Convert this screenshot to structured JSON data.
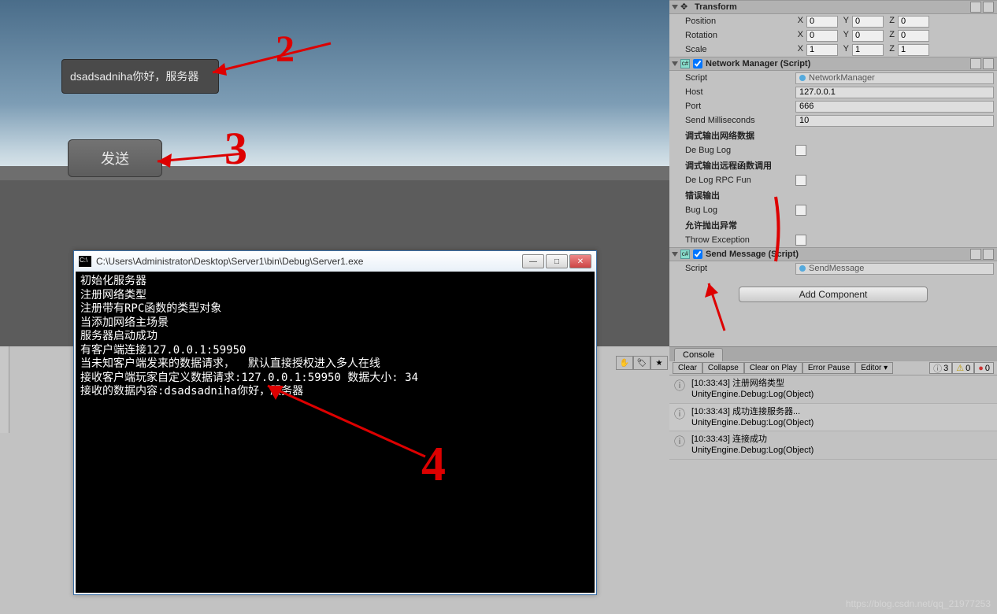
{
  "game": {
    "input_text": "dsadsadniha你好，服务器",
    "send_btn": "发送"
  },
  "cmd": {
    "title": "C:\\Users\\Administrator\\Desktop\\Server1\\bin\\Debug\\Server1.exe",
    "lines": [
      "初始化服务器",
      "注册网络类型",
      "注册带有RPC函数的类型对象",
      "当添加网络主场景",
      "服务器启动成功",
      "有客户端连接127.0.0.1:59950",
      "当未知客户端发来的数据请求，  默认直接授权进入多人在线",
      "接收客户端玩家自定义数据请求:127.0.0.1:59950 数据大小: 34",
      "接收的数据内容:dsadsadniha你好，服务器"
    ]
  },
  "inspector": {
    "transform": {
      "title": "Transform",
      "pos": "Position",
      "rot": "Rotation",
      "scl": "Scale",
      "px": "0",
      "py": "0",
      "pz": "0",
      "rx": "0",
      "ry": "0",
      "rz": "0",
      "sx": "1",
      "sy": "1",
      "sz": "1"
    },
    "netmgr": {
      "title": "Network Manager (Script)",
      "script_label": "Script",
      "script_val": "NetworkManager",
      "host_label": "Host",
      "host_val": "127.0.0.1",
      "port_label": "Port",
      "port_val": "666",
      "ms_label": "Send Milliseconds",
      "ms_val": "10",
      "g1": "调式输出网络数据",
      "g1f": "De Bug Log",
      "g2": "调式输出远程函数调用",
      "g2f": "De Log RPC Fun",
      "g3": "错误输出",
      "g3f": "Bug Log",
      "g4": "允许抛出异常",
      "g4f": "Throw Exception"
    },
    "sendmsg": {
      "title": "Send Message (Script)",
      "script_label": "Script",
      "script_val": "SendMessage"
    },
    "add_component": "Add Component"
  },
  "console": {
    "tab": "Console",
    "buttons": {
      "clear": "Clear",
      "collapse": "Collapse",
      "cop": "Clear on Play",
      "ep": "Error Pause",
      "editor": "Editor ▾"
    },
    "counts": {
      "info": "3",
      "warn": "0",
      "err": "0"
    },
    "logs": [
      {
        "time": "[10:33:43]",
        "msg": "注册网络类型",
        "sub": "UnityEngine.Debug:Log(Object)"
      },
      {
        "time": "[10:33:43]",
        "msg": "成功连接服务器...",
        "sub": "UnityEngine.Debug:Log(Object)"
      },
      {
        "time": "[10:33:43]",
        "msg": "连接成功",
        "sub": "UnityEngine.Debug:Log(Object)"
      }
    ]
  },
  "annotations": {
    "n2": "2",
    "n3": "3",
    "n4": "4"
  },
  "watermark": "https://blog.csdn.net/qq_21977253"
}
